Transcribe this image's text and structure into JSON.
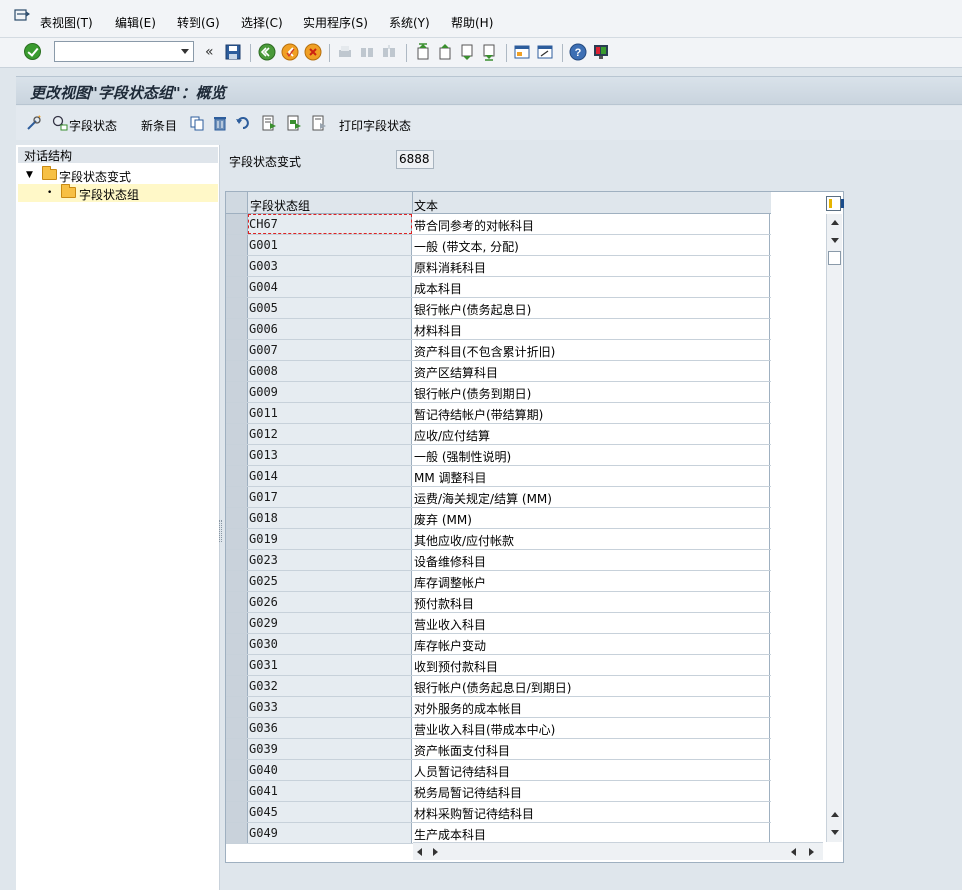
{
  "menubar": {
    "items": [
      "表视图(T)",
      "编辑(E)",
      "转到(G)",
      "选择(C)",
      "实用程序(S)",
      "系统(Y)",
      "帮助(H)"
    ]
  },
  "toolbar": {
    "command_value": "",
    "icons": [
      "enter-icon",
      "save-icon",
      "back-icon",
      "exit-icon",
      "cancel-icon",
      "print-icon",
      "find-icon",
      "find-next-icon",
      "first-page-icon",
      "prev-page-icon",
      "next-page-icon",
      "last-page-icon",
      "new-session-icon",
      "shortcut-icon",
      "help-icon",
      "customize-layout-icon"
    ]
  },
  "title": "更改视图\"字段状态组\"：概览",
  "app_toolbar": {
    "field_status_label": "字段状态",
    "new_entries_label": "新条目",
    "print_field_status_label": "打印字段状态"
  },
  "tree": {
    "header": "对话结构",
    "nodes": [
      {
        "label": "字段状态变式",
        "level": 0,
        "expanded": true
      },
      {
        "label": "字段状态组",
        "level": 1,
        "selected": true
      }
    ]
  },
  "variant": {
    "label": "字段状态变式",
    "value": "6888"
  },
  "table": {
    "columns": [
      "字段状态组",
      "文本"
    ],
    "rows": [
      {
        "group": "CH67",
        "text": "带合同参考的对帐科目"
      },
      {
        "group": "G001",
        "text": "一般 (带文本, 分配)"
      },
      {
        "group": "G003",
        "text": "原料消耗科目"
      },
      {
        "group": "G004",
        "text": "成本科目"
      },
      {
        "group": "G005",
        "text": "银行帐户(债务起息日)"
      },
      {
        "group": "G006",
        "text": "材料科目"
      },
      {
        "group": "G007",
        "text": "资产科目(不包含累计折旧)"
      },
      {
        "group": "G008",
        "text": "资产区结算科目"
      },
      {
        "group": "G009",
        "text": "银行帐户(债务到期日)"
      },
      {
        "group": "G011",
        "text": "暂记待结帐户(带结算期)"
      },
      {
        "group": "G012",
        "text": "应收/应付结算"
      },
      {
        "group": "G013",
        "text": "一般 (强制性说明)"
      },
      {
        "group": "G014",
        "text": "MM 调整科目"
      },
      {
        "group": "G017",
        "text": "运费/海关规定/结算 (MM)"
      },
      {
        "group": "G018",
        "text": "废弃 (MM)"
      },
      {
        "group": "G019",
        "text": "其他应收/应付帐款"
      },
      {
        "group": "G023",
        "text": "设备维修科目"
      },
      {
        "group": "G025",
        "text": "库存调整帐户"
      },
      {
        "group": "G026",
        "text": "预付款科目"
      },
      {
        "group": "G029",
        "text": "营业收入科目"
      },
      {
        "group": "G030",
        "text": "库存帐户变动"
      },
      {
        "group": "G031",
        "text": "收到预付款科目"
      },
      {
        "group": "G032",
        "text": "银行帐户(债务起息日/到期日)"
      },
      {
        "group": "G033",
        "text": "对外服务的成本帐目"
      },
      {
        "group": "G036",
        "text": "营业收入科目(带成本中心)"
      },
      {
        "group": "G039",
        "text": "资产帐面支付科目"
      },
      {
        "group": "G040",
        "text": "人员暂记待结科目"
      },
      {
        "group": "G041",
        "text": "税务局暂记待结科目"
      },
      {
        "group": "G045",
        "text": "材料采购暂记待结科目"
      },
      {
        "group": "G049",
        "text": "生产成本科目"
      }
    ]
  },
  "colors": {
    "accent_green": "#3a9b2f",
    "folder_yellow": "#f7c044",
    "selected_tree_row": "#fff8c8"
  }
}
